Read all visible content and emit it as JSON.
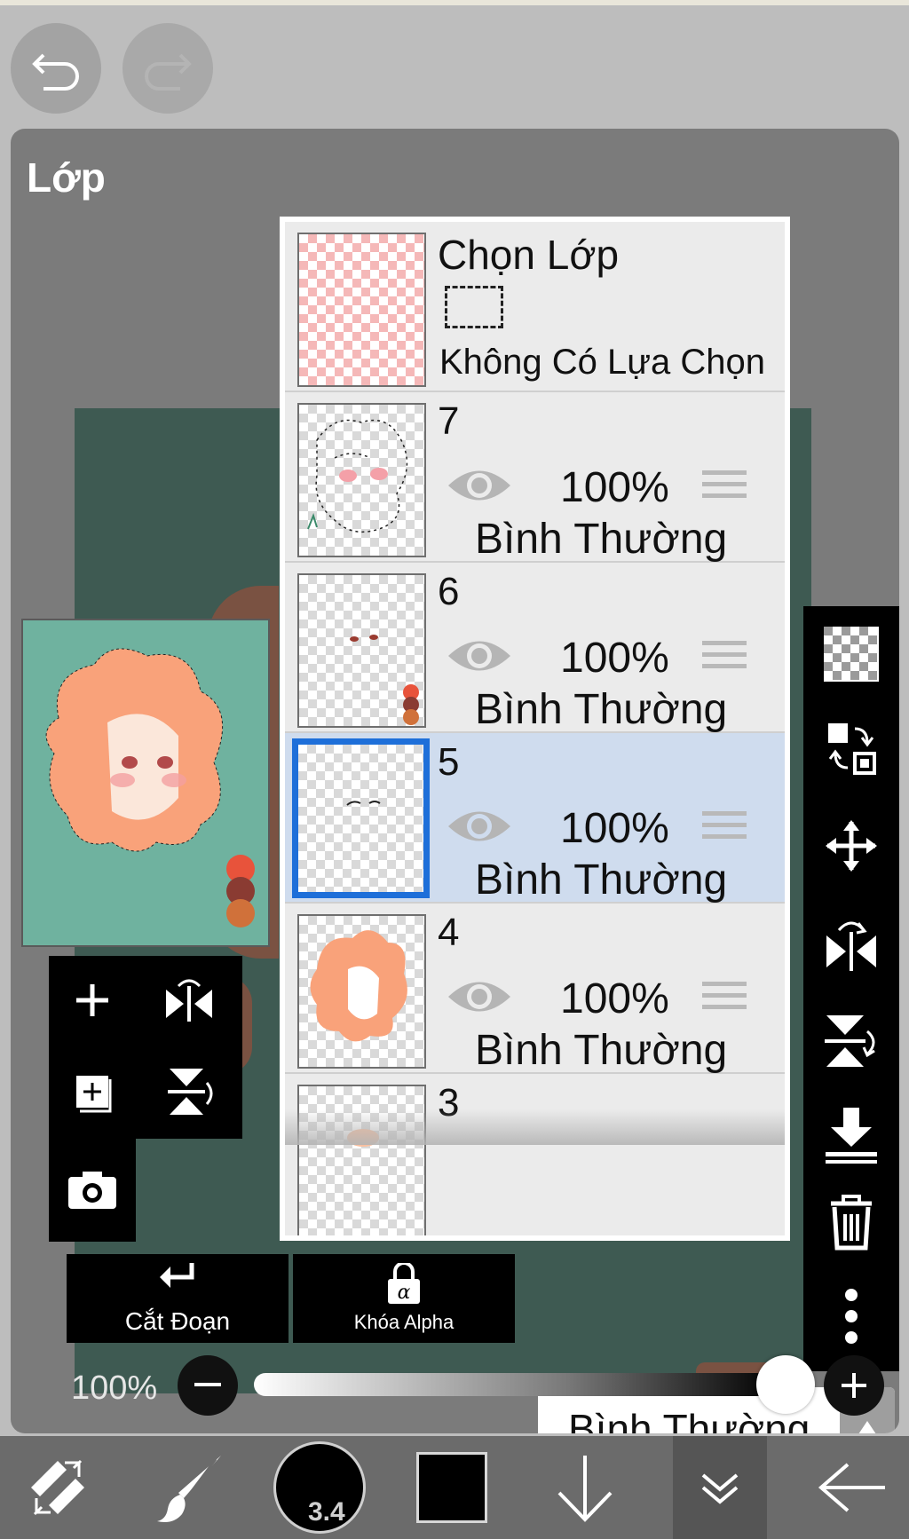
{
  "panel": {
    "title": "Lớp"
  },
  "selection_layer": {
    "title": "Chọn Lớp",
    "status": "Không Có Lựa Chọn"
  },
  "layers": [
    {
      "number": "7",
      "opacity": "100%",
      "blend": "Bình Thường",
      "visible": true,
      "selected": false
    },
    {
      "number": "6",
      "opacity": "100%",
      "blend": "Bình Thường",
      "visible": true,
      "selected": false
    },
    {
      "number": "5",
      "opacity": "100%",
      "blend": "Bình Thường",
      "visible": true,
      "selected": true
    },
    {
      "number": "4",
      "opacity": "100%",
      "blend": "Bình Thường",
      "visible": true,
      "selected": false
    },
    {
      "number": "3"
    }
  ],
  "actions": {
    "clipping_label": "Cắt Đoạn",
    "alpha_lock_label": "Khóa Alpha",
    "blend_mode_value": "Bình Thường"
  },
  "opacity_slider": {
    "label": "100%",
    "value": 1.0
  },
  "bottom_toolbar": {
    "brush_size": "3.4",
    "color": "#000000"
  },
  "colors": {
    "selected_row": "#cfdcee",
    "selected_border": "#1e6fd9",
    "canvas": "#3e5a52",
    "preview_bg": "#6fb29f",
    "hair": "#f9a27a"
  }
}
